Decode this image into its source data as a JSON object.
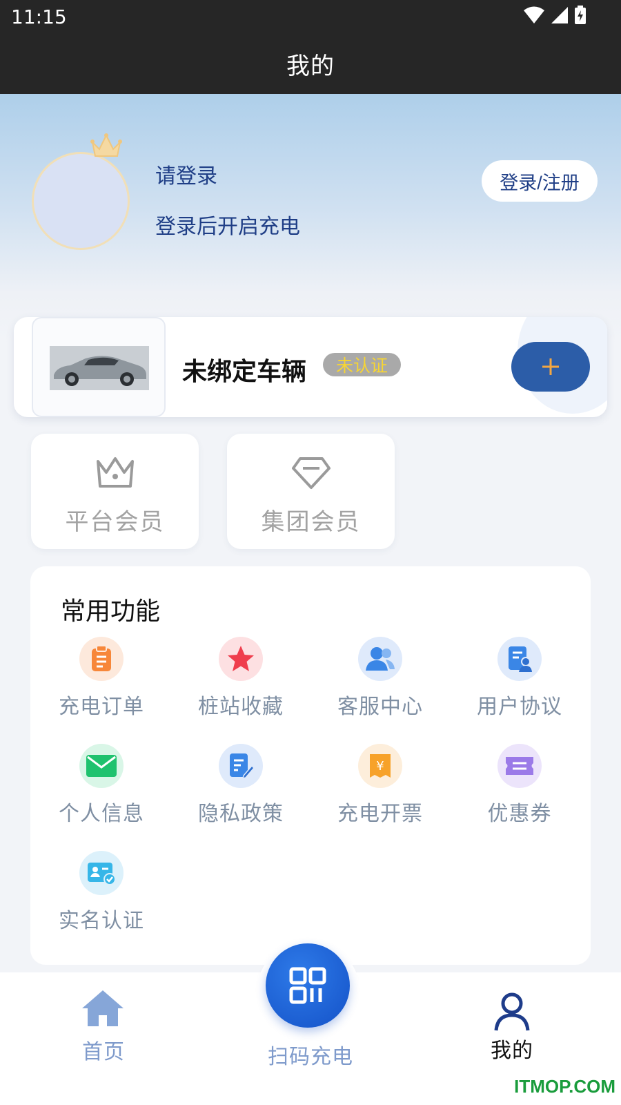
{
  "status_bar": {
    "time": "11:15"
  },
  "page": {
    "title": "我的"
  },
  "profile": {
    "title": "请登录",
    "subtitle": "登录后开启充电",
    "login_button": "登录/注册"
  },
  "vehicle": {
    "name": "未绑定车辆",
    "badge": "未认证",
    "add_symbol": "+"
  },
  "memberships": [
    {
      "label": "平台会员",
      "icon": "crown-icon"
    },
    {
      "label": "集团会员",
      "icon": "diamond-icon"
    }
  ],
  "functions": {
    "title": "常用功能",
    "items": [
      {
        "label": "充电订单",
        "icon": "clipboard-icon",
        "color": "#f7873a"
      },
      {
        "label": "桩站收藏",
        "icon": "star-icon",
        "color": "#ef3e4d"
      },
      {
        "label": "客服中心",
        "icon": "users-icon",
        "color": "#3a86e6"
      },
      {
        "label": "用户协议",
        "icon": "document-user-icon",
        "color": "#3a86e6"
      },
      {
        "label": "个人信息",
        "icon": "mail-icon",
        "color": "#1fc26e"
      },
      {
        "label": "隐私政策",
        "icon": "document-edit-icon",
        "color": "#3a86e6"
      },
      {
        "label": "充电开票",
        "icon": "invoice-icon",
        "color": "#f7a22a"
      },
      {
        "label": "优惠券",
        "icon": "coupon-icon",
        "color": "#9b7ae8"
      },
      {
        "label": "实名认证",
        "icon": "id-card-icon",
        "color": "#36b6e8"
      }
    ]
  },
  "bottom_nav": {
    "home": "首页",
    "scan": "扫码充电",
    "mine": "我的"
  },
  "colors": {
    "primary_blue": "#1f3e86",
    "add_button": "#2c5da8",
    "scan_button": "#1a5fd6"
  },
  "watermark": "ITMOP.COM"
}
